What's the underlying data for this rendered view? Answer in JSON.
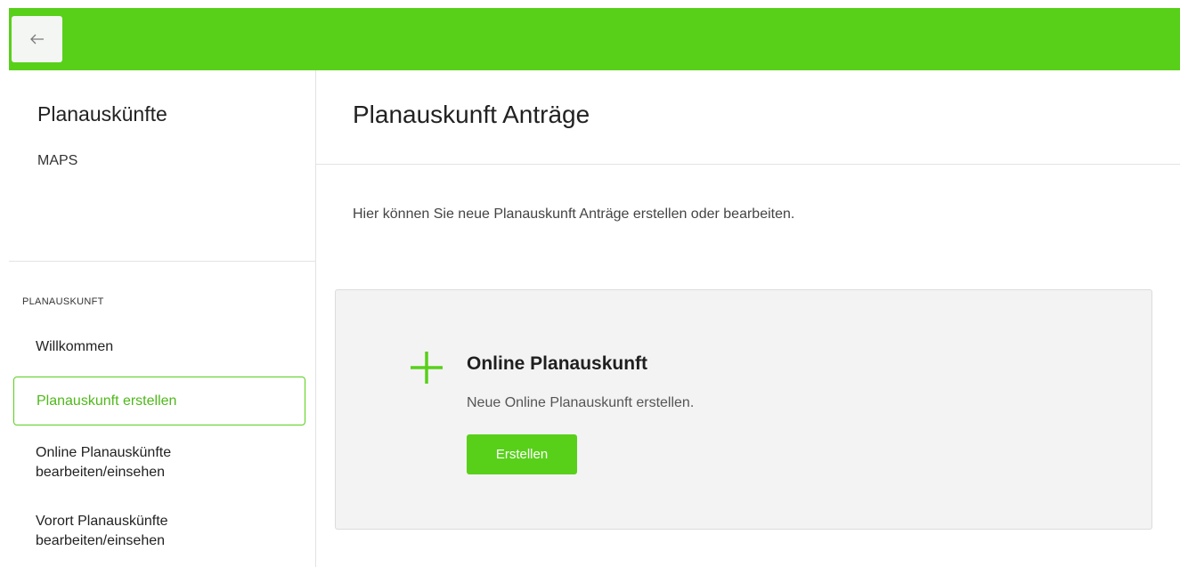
{
  "colors": {
    "accent": "#58d01a",
    "active_text": "#4fb81a",
    "card_background": "#f3f3f3"
  },
  "topbar": {
    "back_icon": "arrow-left-icon"
  },
  "sidebar": {
    "title": "Planauskünfte",
    "subtitle": "MAPS",
    "section_label": "PLANAUSKUNFT",
    "items": [
      {
        "label": "Willkommen",
        "active": false
      },
      {
        "label": "Planauskunft erstellen",
        "active": true
      },
      {
        "label": "Online Planauskünfte bearbeiten/einsehen",
        "active": false
      },
      {
        "label": "Vorort Planauskünfte bearbeiten/einsehen",
        "active": false
      }
    ]
  },
  "main": {
    "title": "Planauskunft Anträge",
    "intro": "Hier können Sie neue Planauskunft Anträge erstellen oder bearbeiten.",
    "card": {
      "icon": "plus-icon",
      "title": "Online Planauskunft",
      "description": "Neue Online Planauskunft erstellen.",
      "button_label": "Erstellen"
    }
  }
}
